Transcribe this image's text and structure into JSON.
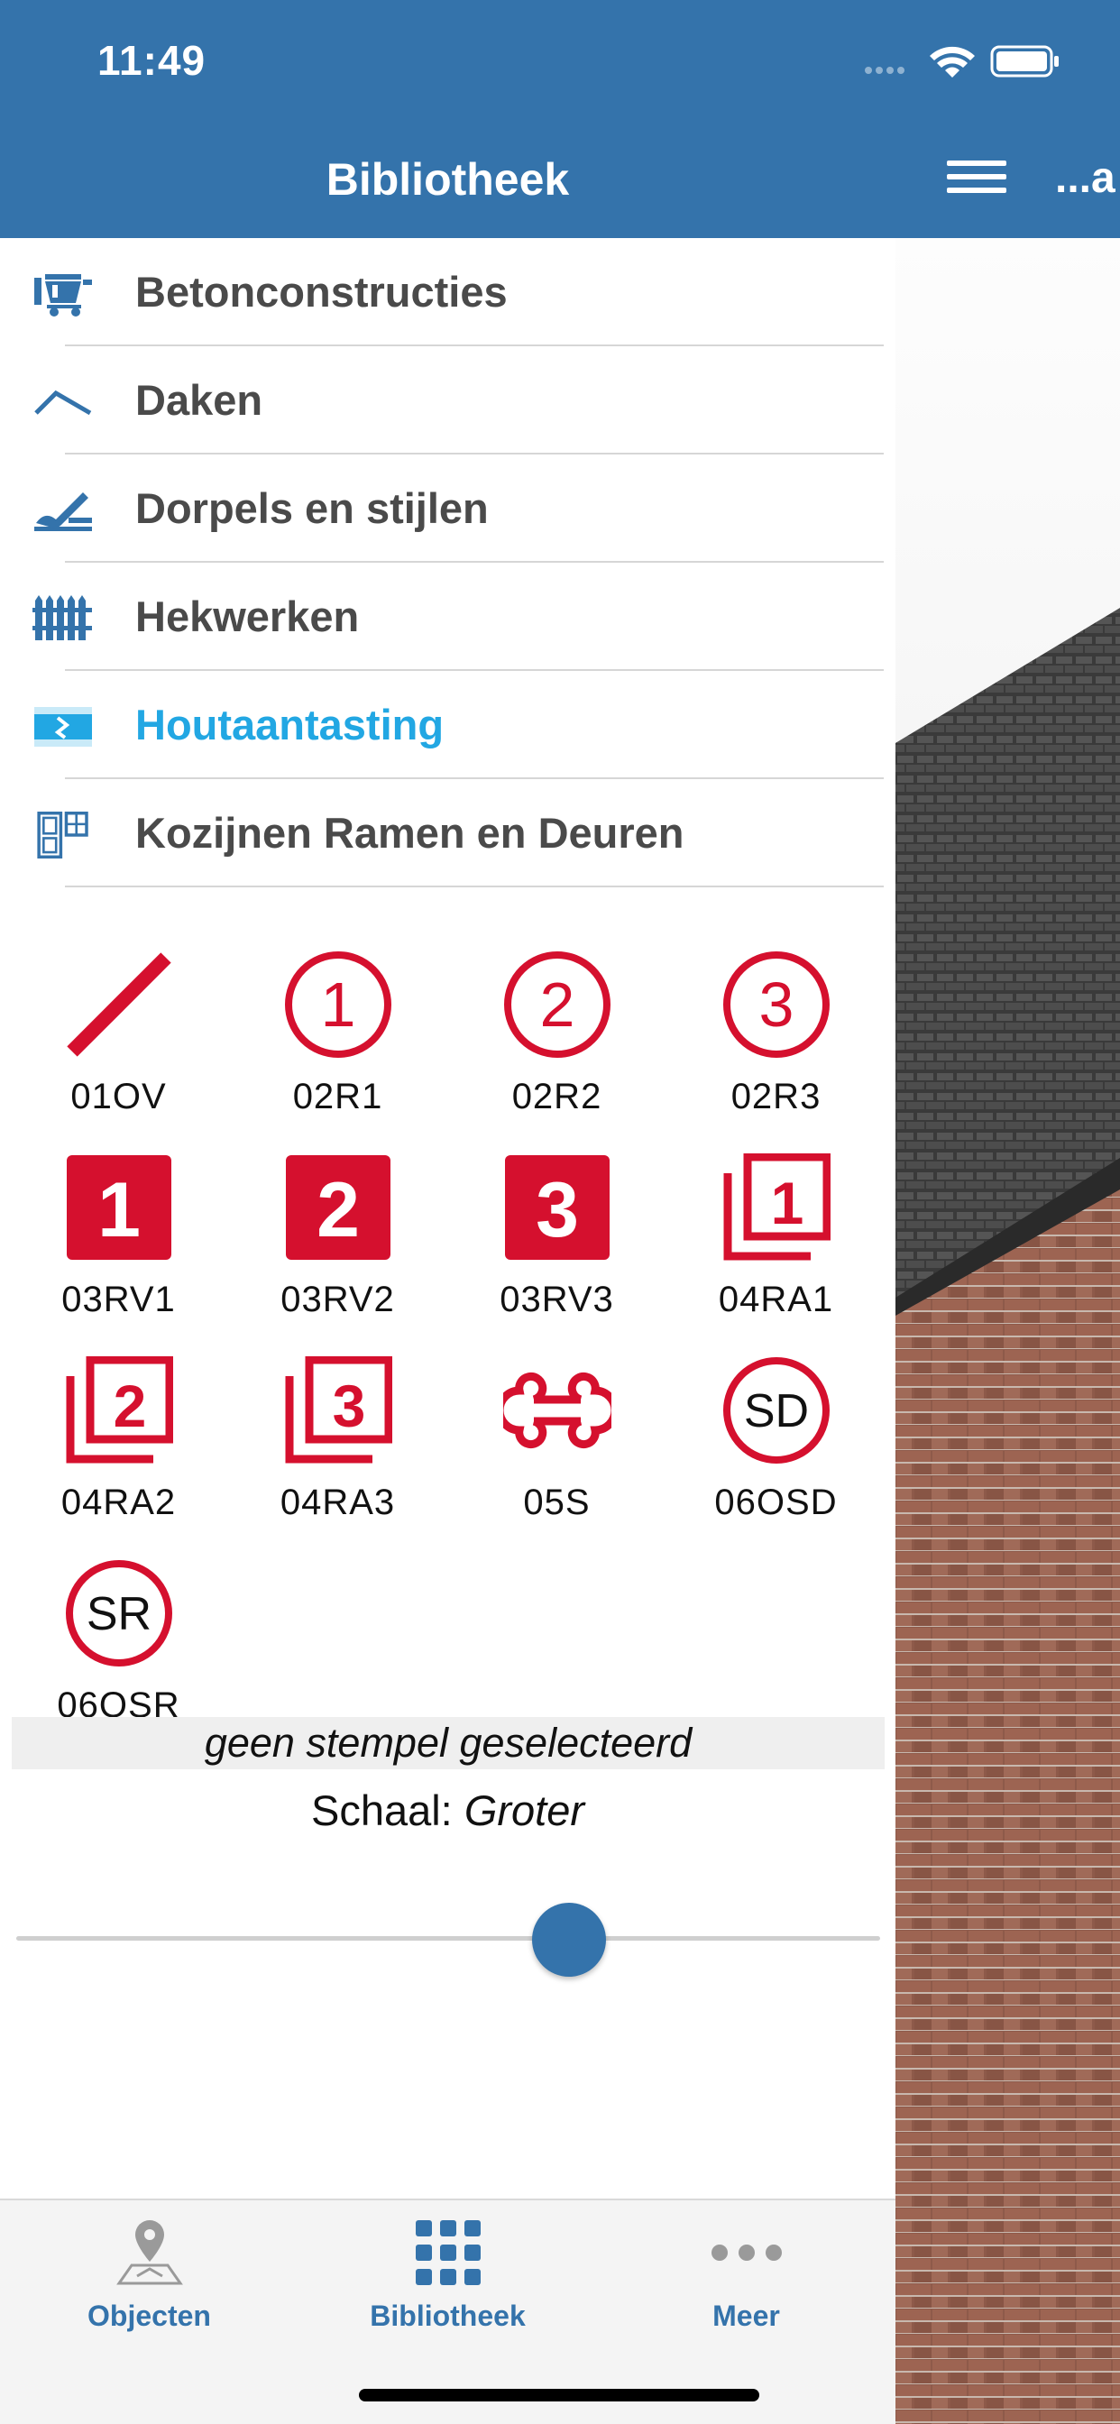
{
  "status_bar": {
    "time": "11:49"
  },
  "header": {
    "title": "Bibliotheek",
    "overflow_title": "...a"
  },
  "categories": [
    {
      "label": "Betonconstructies",
      "icon": "concrete-mixer-icon",
      "active": false
    },
    {
      "label": "Daken",
      "icon": "roof-icon",
      "active": false
    },
    {
      "label": "Dorpels en stijlen",
      "icon": "sill-icon",
      "active": false
    },
    {
      "label": "Hekwerken",
      "icon": "fence-icon",
      "active": false
    },
    {
      "label": "Houtaantasting",
      "icon": "wood-decay-icon",
      "active": true
    },
    {
      "label": "Kozijnen Ramen en Deuren",
      "icon": "window-frame-icon",
      "active": false
    }
  ],
  "stamps": [
    {
      "code": "01OV",
      "icon": "diagonal-slash-icon"
    },
    {
      "code": "02R1",
      "icon": "circle-1-icon",
      "text": "1"
    },
    {
      "code": "02R2",
      "icon": "circle-2-icon",
      "text": "2"
    },
    {
      "code": "02R3",
      "icon": "circle-3-icon",
      "text": "3"
    },
    {
      "code": "03RV1",
      "icon": "filled-square-1-icon",
      "text": "1"
    },
    {
      "code": "03RV2",
      "icon": "filled-square-2-icon",
      "text": "2"
    },
    {
      "code": "03RV3",
      "icon": "filled-square-3-icon",
      "text": "3"
    },
    {
      "code": "04RA1",
      "icon": "stacked-square-1-icon",
      "text": "1"
    },
    {
      "code": "04RA2",
      "icon": "stacked-square-2-icon",
      "text": "2"
    },
    {
      "code": "04RA3",
      "icon": "stacked-square-3-icon",
      "text": "3"
    },
    {
      "code": "05S",
      "icon": "bone-icon"
    },
    {
      "code": "06OSD",
      "icon": "circle-sd-icon",
      "text": "SD"
    },
    {
      "code": "06OSR",
      "icon": "circle-sr-icon",
      "text": "SR"
    }
  ],
  "selection": {
    "status": "geen stempel geselecteerd"
  },
  "scale": {
    "label": "Schaal:",
    "value": "Groter",
    "slider_fraction": 0.64
  },
  "tabs": [
    {
      "label": "Objecten",
      "icon": "map-pin-icon"
    },
    {
      "label": "Bibliotheek",
      "icon": "grid-dots-icon"
    },
    {
      "label": "Meer",
      "icon": "more-dots-icon"
    }
  ],
  "colors": {
    "brand": "#3473ab",
    "active": "#22a7e3",
    "stamp_red": "#d5102e"
  }
}
